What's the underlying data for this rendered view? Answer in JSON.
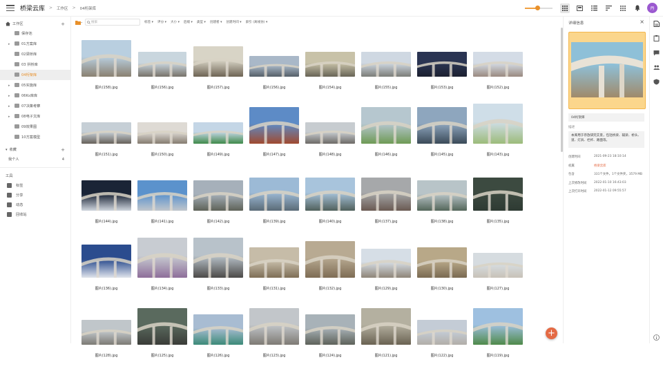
{
  "app": {
    "title": "桥梁云库"
  },
  "breadcrumb": {
    "root": "工作区",
    "sep": ">",
    "current": "04桁架库"
  },
  "toolbar": {
    "zoom_level": 0.45,
    "avatar_initial": "丹",
    "accent": "#e8902a"
  },
  "sidebar": {
    "workspace_label": "工作区",
    "folders": [
      {
        "label": "保存池",
        "expandable": false
      },
      {
        "label": "01方案库",
        "expandable": true
      },
      {
        "label": "02梁桥库",
        "expandable": false
      },
      {
        "label": "03 拱桥库",
        "expandable": false
      },
      {
        "label": "04桁架库",
        "expandable": false,
        "selected": true
      },
      {
        "label": "05实施库",
        "expandable": true
      },
      {
        "label": "06Ks库库",
        "expandable": true
      },
      {
        "label": "07决策考察",
        "expandable": true
      },
      {
        "label": "08电子文库",
        "expandable": true
      },
      {
        "label": "09效果图",
        "expandable": false
      },
      {
        "label": "10方案模型",
        "expandable": false
      }
    ],
    "favorites_label": "收藏",
    "favorites": [
      {
        "label": "我个人",
        "count": "4"
      }
    ],
    "tools_label": "工具",
    "tools": [
      {
        "label": "标签",
        "icon": "tag-icon"
      },
      {
        "label": "分享",
        "icon": "share-icon"
      },
      {
        "label": "动态",
        "icon": "activity-icon"
      },
      {
        "label": "回收站",
        "icon": "trash-icon"
      }
    ]
  },
  "filterbar": {
    "search_placeholder": "搜索",
    "filters": [
      "标签 ▾",
      "评分 ▾",
      "大小 ▾",
      "后缀 ▾",
      "类型 ▾",
      "创建者 ▾",
      "创建时间 ▾",
      "索引 (离线仿) ▾"
    ]
  },
  "files": [
    {
      "name": "图片(158).jpg",
      "sky": "#b9cfe0",
      "body": "#8a8070",
      "w": 72,
      "h": 53
    },
    {
      "name": "图片(156).jpg",
      "sky": "#c9d6de",
      "body": "#77736a",
      "w": 70,
      "h": 36
    },
    {
      "name": "图片(157).jpg",
      "sky": "#d8d4c6",
      "body": "#6e6454",
      "w": 72,
      "h": 44
    },
    {
      "name": "图片(156).jpg",
      "sky": "#a9b8c8",
      "body": "#555f68",
      "w": 72,
      "h": 30
    },
    {
      "name": "图片(154).jpg",
      "sky": "#c8c2a8",
      "body": "#686456",
      "w": 72,
      "h": 36
    },
    {
      "name": "图片(155).jpg",
      "sky": "#cfd8e2",
      "body": "#7b7d78",
      "w": 72,
      "h": 36
    },
    {
      "name": "图片(153).jpg",
      "sky": "#2a3452",
      "body": "#1c2030",
      "w": 72,
      "h": 36
    },
    {
      "name": "图片(152).jpg",
      "sky": "#d4dce6",
      "body": "#9a8a80",
      "w": 72,
      "h": 36
    },
    {
      "name": "图片(151).jpg",
      "sky": "#c6cfd6",
      "body": "#67615a",
      "w": 72,
      "h": 31
    },
    {
      "name": "图片(150).jpg",
      "sky": "#dedad4",
      "body": "#857c70",
      "w": 72,
      "h": 31
    },
    {
      "name": "图片(149).jpg",
      "sky": "#c4d6e6",
      "body": "#3f8a4a",
      "w": 72,
      "h": 31
    },
    {
      "name": "图片(147).jpg",
      "sky": "#5d8bc6",
      "body": "#a04a30",
      "w": 72,
      "h": 53
    },
    {
      "name": "图片(148).jpg",
      "sky": "#c7ccd0",
      "body": "#6d6a66",
      "w": 72,
      "h": 31
    },
    {
      "name": "图片(146).jpg",
      "sky": "#b6c7cf",
      "body": "#6e9a55",
      "w": 72,
      "h": 53
    },
    {
      "name": "图片(145).jpg",
      "sky": "#8ea6be",
      "body": "#3b4a58",
      "w": 72,
      "h": 53
    },
    {
      "name": "图片(143).jpg",
      "sky": "#cfdee8",
      "body": "#9cbb7a",
      "w": 72,
      "h": 58
    },
    {
      "name": "图片(144).jpg",
      "sky": "#1a2436",
      "body": "#d0d6de",
      "w": 72,
      "h": 44
    },
    {
      "name": "图片(141).jpg",
      "sky": "#5b92cc",
      "body": "#c0c6cc",
      "w": 72,
      "h": 44
    },
    {
      "name": "图片(142).jpg",
      "sky": "#a6b0ba",
      "body": "#5e6258",
      "w": 72,
      "h": 44
    },
    {
      "name": "图片(139).jpg",
      "sky": "#9cbad6",
      "body": "#5a6a76",
      "w": 72,
      "h": 48
    },
    {
      "name": "图片(140).jpg",
      "sky": "#a8c4dc",
      "body": "#50605c",
      "w": 72,
      "h": 48
    },
    {
      "name": "图片(137).jpg",
      "sky": "#a6a8aa",
      "body": "#6a5a52",
      "w": 72,
      "h": 48
    },
    {
      "name": "图片(138).jpg",
      "sky": "#b8c4c8",
      "body": "#54665a",
      "w": 72,
      "h": 44
    },
    {
      "name": "图片(135).jpg",
      "sky": "#3c4a40",
      "body": "#2e3a33",
      "w": 72,
      "h": 48
    },
    {
      "name": "图片(136).jpg",
      "sky": "#2b4c8e",
      "body": "#e0e4ec",
      "w": 72,
      "h": 48
    },
    {
      "name": "图片(134).jpg",
      "sky": "#c8ccd2",
      "body": "#8e6e9a",
      "w": 72,
      "h": 58
    },
    {
      "name": "图片(133).jpg",
      "sky": "#b8c2ca",
      "body": "#4c4a48",
      "w": 72,
      "h": 58
    },
    {
      "name": "图片(131).jpg",
      "sky": "#c6bca8",
      "body": "#7e6e56",
      "w": 72,
      "h": 44
    },
    {
      "name": "图片(132).jpg",
      "sky": "#b8aa92",
      "body": "#7e6c54",
      "w": 72,
      "h": 53
    },
    {
      "name": "图片(129).jpg",
      "sky": "#d6dee6",
      "body": "#8e8578",
      "w": 72,
      "h": 42
    },
    {
      "name": "图片(130).jpg",
      "sky": "#b8a888",
      "body": "#7a6a52",
      "w": 72,
      "h": 44
    },
    {
      "name": "图片(127).jpg",
      "sky": "#d6dce0",
      "body": "#c8c2b8",
      "w": 72,
      "h": 36
    },
    {
      "name": "图片(128).jpg",
      "sky": "#c0c6ca",
      "body": "#7c7a74",
      "w": 72,
      "h": 36
    },
    {
      "name": "图片(125).jpg",
      "sky": "#5a6a5e",
      "body": "#3a3c38",
      "w": 72,
      "h": 53
    },
    {
      "name": "图片(126).jpg",
      "sky": "#a8bcd2",
      "body": "#3c8a78",
      "w": 72,
      "h": 44
    },
    {
      "name": "图片(123).jpg",
      "sky": "#c2c6ca",
      "body": "#7e7a74",
      "w": 72,
      "h": 53
    },
    {
      "name": "图片(124).jpg",
      "sky": "#a8b2b8",
      "body": "#5e625a",
      "w": 72,
      "h": 44
    },
    {
      "name": "图片(121).jpg",
      "sky": "#b4b0a0",
      "body": "#6a6252",
      "w": 72,
      "h": 53
    },
    {
      "name": "图片(122).jpg",
      "sky": "#c4ccd6",
      "body": "#b2aea8",
      "w": 72,
      "h": 36
    },
    {
      "name": "图片(119).jpg",
      "sky": "#9ec0e0",
      "body": "#4f8a4a",
      "w": 72,
      "h": 53
    }
  ],
  "details": {
    "title": "详细信息",
    "name_value": "04桁架库",
    "desc_label": "描述",
    "desc_value": "本库用于存放研究实景，包括桥梁、辅梁、桥头、道、灯具、栏杆、路面等。",
    "preview_sky": "#8ec0d8",
    "preview_body": "#a08a6a",
    "rows": [
      {
        "label": "创建时间",
        "value": "2021-09-23 18:10:14",
        "accent": false
      },
      {
        "label": "权属",
        "value": "桥梁云库",
        "accent": true
      },
      {
        "label": "包含",
        "value": "331个文件，1个文件夹，3579 MB",
        "accent": false
      },
      {
        "label": "上次修改时间",
        "value": "2022-01-10 16:43:03",
        "accent": false
      },
      {
        "label": "上次打开时间",
        "value": "2022-01-12 09:55:57",
        "accent": false
      }
    ]
  },
  "rightbar": {
    "icons": [
      "details-icon",
      "clipboard-icon",
      "comment-icon",
      "people-icon",
      "shield-icon",
      "info-icon"
    ]
  }
}
